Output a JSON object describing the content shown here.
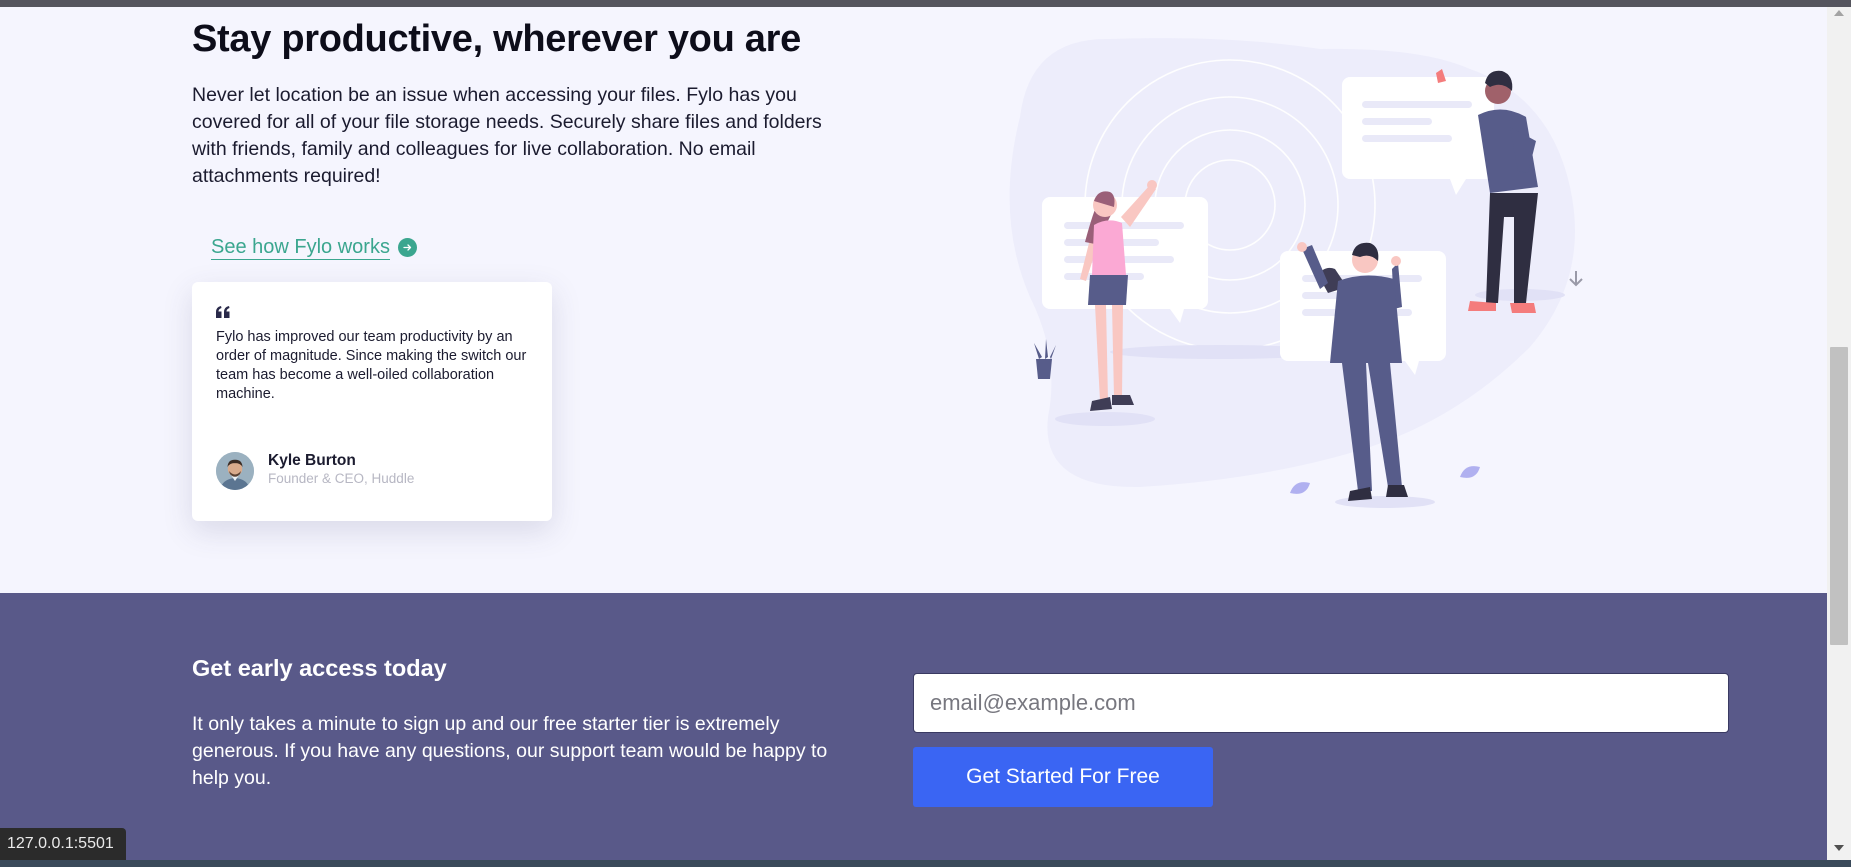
{
  "hero": {
    "title": "Stay productive, wherever you are",
    "description": "Never let location be an issue when accessing your files. Fylo has you covered for all of your file storage needs. Securely share files and folders with friends, family and colleagues for live collaboration. No email attachments required!",
    "link_label": "See how Fylo works",
    "link_icon": "arrow-right-icon",
    "illustration": "stay-productive-illustration"
  },
  "testimonial": {
    "quote_icon": "quote-icon",
    "quote": "Fylo has improved our team productivity by an order of magnitude. Since making the switch our team has become a well-oiled collaboration machine.",
    "author_name": "Kyle Burton",
    "author_role": "Founder & CEO, Huddle"
  },
  "cta": {
    "title": "Get early access today",
    "description": "It only takes a minute to sign up and our free starter tier is extremely generous. If you have any questions, our support team would be happy to help you.",
    "email_placeholder": "email@example.com",
    "email_value": "",
    "button_label": "Get Started For Free"
  },
  "browser": {
    "status_url": "127.0.0.1:5501"
  },
  "colors": {
    "hero_bg": "#f5f5fe",
    "link_accent": "#3ba68f",
    "cta_bg": "#595989",
    "button_bg": "#3a65f3"
  }
}
